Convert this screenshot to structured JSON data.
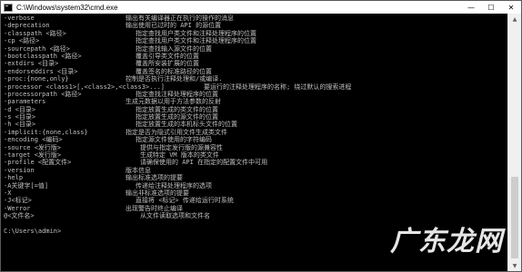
{
  "window": {
    "title": "C:\\Windows\\system32\\cmd.exe",
    "icon": "cmd-icon",
    "controls": {
      "minimize": "—",
      "maximize": "☐",
      "close": "✕"
    }
  },
  "console": {
    "lines": [
      {
        "opt": "-verbose",
        "desc": "输出有关编译器正在执行的操作的消息",
        "indent": false
      },
      {
        "opt": "-deprecation",
        "desc": "输出使用已过时的 API 的源位置",
        "indent": false
      },
      {
        "opt": "-classpath <路径>",
        "desc": "指定查找用户类文件和注释处理程序的位置",
        "indent": true
      },
      {
        "opt": "-cp <路径>",
        "desc": "指定查找用户类文件和注释处理程序的位置",
        "indent": true
      },
      {
        "opt": "-sourcepath <路径>",
        "desc": "指定查找输入源文件的位置",
        "indent": true
      },
      {
        "opt": "-bootclasspath <路径>",
        "desc": "覆盖引导类文件的位置",
        "indent": true
      },
      {
        "opt": "-extdirs <目录>",
        "desc": "覆盖所安装扩展的位置",
        "indent": true
      },
      {
        "opt": "-endorseddirs <目录>",
        "desc": "覆盖签名的标准路径的位置",
        "indent": true
      },
      {
        "opt": "-proc:{none,only}",
        "desc": "控制是否执行注释处理和/或编译.",
        "indent": false
      },
      {
        "opt": "-processor <class1>[,<class2>,<class3>...]",
        "desc": "要运行的注释处理程序的名称; 绕过默认的搜索进程",
        "indent": false,
        "full": true
      },
      {
        "opt": "-processorpath <路径>",
        "desc": "指定查找注释处理程序的位置",
        "indent": true
      },
      {
        "opt": "-parameters",
        "desc": "生成元数据以用于方法参数的反射",
        "indent": false
      },
      {
        "opt": "-d <目录>",
        "desc": "指定放置生成的类文件的位置",
        "indent": true
      },
      {
        "opt": "-s <目录>",
        "desc": "指定放置生成的源文件的位置",
        "indent": true
      },
      {
        "opt": "-h <目录>",
        "desc": "指定放置生成的本机标头文件的位置",
        "indent": true
      },
      {
        "opt": "-implicit:{none,class}",
        "desc": "指定是否为隐式引用文件生成类文件",
        "indent": false
      },
      {
        "opt": "-encoding <编码>",
        "desc": "指定源文件使用的字符编码",
        "indent": true
      },
      {
        "opt": "-source <发行版>",
        "desc": "提供与指定发行版的源兼容性",
        "indent": true,
        "extra": true
      },
      {
        "opt": "-target <发行版>",
        "desc": "生成特定 VM 版本的类文件",
        "indent": true,
        "extra": true
      },
      {
        "opt": "-profile <配置文件>",
        "desc": "请确保使用的 API 在指定的配置文件中可用",
        "indent": true,
        "extra": true
      },
      {
        "opt": "-version",
        "desc": "版本信息",
        "indent": false
      },
      {
        "opt": "-help",
        "desc": "输出标准选项的提要",
        "indent": false
      },
      {
        "opt": "-A关键字[=值]",
        "desc": "传递给注释处理程序的选项",
        "indent": true
      },
      {
        "opt": "-X",
        "desc": "输出非标准选项的提要",
        "indent": false
      },
      {
        "opt": "-J<标记>",
        "desc": "直接将 <标记> 传递给运行时系统",
        "indent": true
      },
      {
        "opt": "-Werror",
        "desc": "出现警告时终止编译",
        "indent": false
      },
      {
        "opt": "@<文件名>",
        "desc": "从文件读取选项和文件名",
        "indent": true,
        "extra": true
      }
    ],
    "prompt": "C:\\Users\\admin>"
  },
  "scrollbar": {
    "up": "▲",
    "down": "▼"
  },
  "watermark": "广东龙网"
}
